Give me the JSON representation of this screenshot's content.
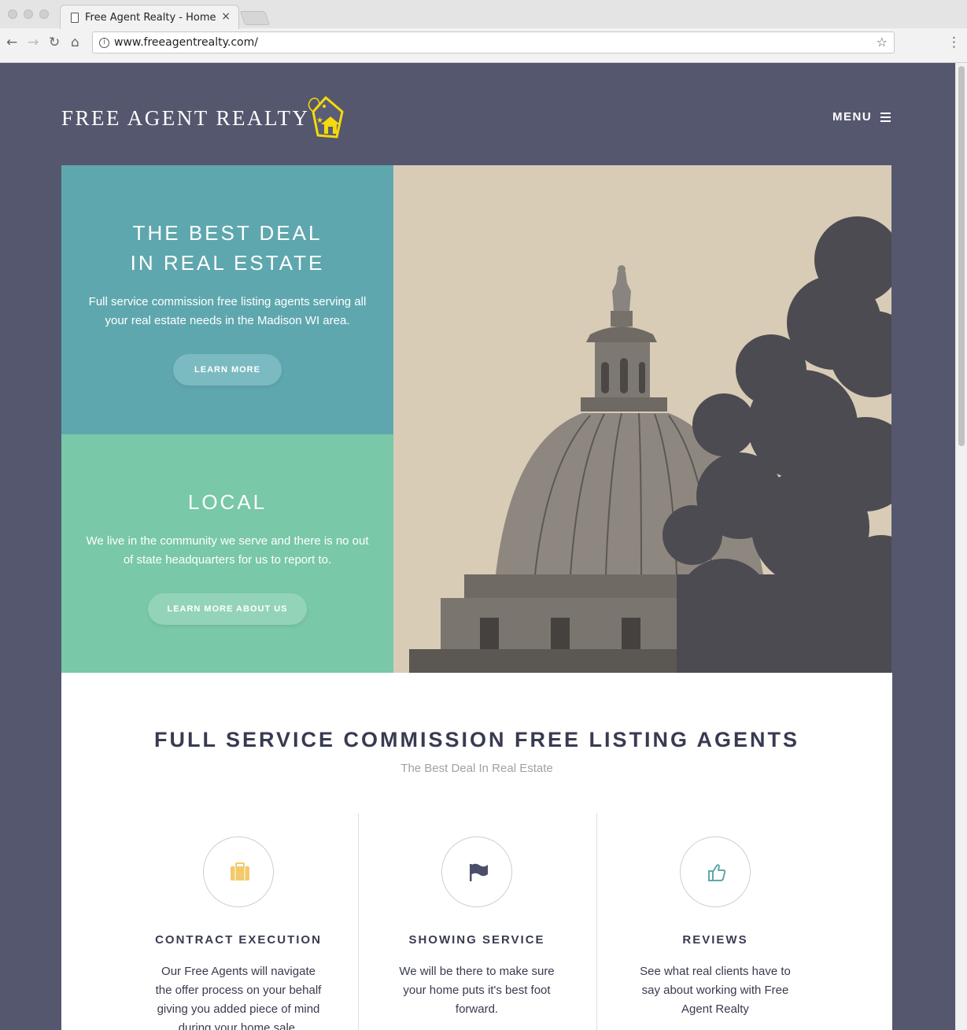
{
  "browser": {
    "tab_title": "Free Agent Realty - Home",
    "tab_close": "×",
    "url": "www.freeagentrealty.com/",
    "back_icon": "arrow-left-icon",
    "forward_icon": "arrow-right-icon",
    "reload_icon": "reload-icon",
    "home_icon": "home-icon",
    "info_icon": "info-icon",
    "bookmark_icon": "star-icon",
    "menu_icon": "kebab-icon"
  },
  "header": {
    "logo_text": "FREE AGENT REALTY",
    "menu_label": "MENU"
  },
  "hero": {
    "primary": {
      "title_line1": "THE BEST DEAL",
      "title_line2": "IN REAL ESTATE",
      "text_line1": "Full service commission free listing agents serving all",
      "text_line2": "your real estate needs in the Madison WI area.",
      "button": "LEARN MORE"
    },
    "secondary": {
      "title": "LOCAL",
      "text_line1": "We live in the community we serve and there is no out",
      "text_line2": "of state headquarters for us to report to.",
      "button": "LEARN MORE ABOUT US"
    }
  },
  "services": {
    "title": "FULL SERVICE COMMISSION FREE LISTING AGENTS",
    "subtitle": "The Best Deal In Real Estate",
    "items": [
      {
        "icon": "briefcase-icon",
        "title": "CONTRACT EXECUTION",
        "lines": [
          "Our Free Agents will navigate",
          "the offer process on your behalf",
          "giving you added piece of mind",
          "during your home sale."
        ]
      },
      {
        "icon": "flag-icon",
        "title": "SHOWING SERVICE",
        "lines": [
          "We will be there to make sure",
          "your home puts it's best foot",
          "forward."
        ]
      },
      {
        "icon": "thumbs-up-icon",
        "title": "REVIEWS",
        "lines": [
          "See what real clients have to",
          "say about working with Free",
          "Agent Realty"
        ]
      }
    ]
  },
  "colors": {
    "background": "#55576e",
    "teal": "#5fa7ae",
    "green": "#79c8a8",
    "heading": "#383b50",
    "briefcase": "#f3c96b",
    "logo_tag": "#f5d90a"
  }
}
